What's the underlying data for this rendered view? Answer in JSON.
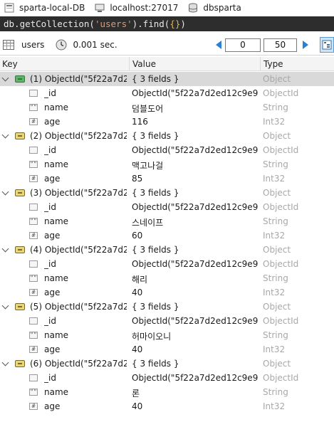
{
  "connection": {
    "db_name": "sparta-local-DB",
    "host": "localhost:27017",
    "database": "dbsparta"
  },
  "query": {
    "prefix": "db.getCollection(",
    "collection_literal": "'users'",
    "middle": ").find(",
    "braces": "{}",
    "suffix": ")"
  },
  "toolbar": {
    "collection": "users",
    "elapsed": "0.001 sec.",
    "skip": "0",
    "limit": "50"
  },
  "columns": {
    "key": "Key",
    "value": "Value",
    "type": "Type"
  },
  "documents": [
    {
      "label": "(1) ObjectId(\"5f22a7d2...",
      "value": "{ 3 fields }",
      "type": "Object",
      "fields": [
        {
          "key": "_id",
          "icon": "objectid-field-icon",
          "glyph": "",
          "value": "ObjectId(\"5f22a7d2ed12c9e9e...",
          "type": "ObjectId"
        },
        {
          "key": "name",
          "icon": "string-field-icon",
          "glyph": "\"\"",
          "value": "덤블도어",
          "type": "String"
        },
        {
          "key": "age",
          "icon": "int-field-icon",
          "glyph": "#",
          "value": "116",
          "type": "Int32"
        }
      ]
    },
    {
      "label": "(2) ObjectId(\"5f22a7d2...",
      "value": "{ 3 fields }",
      "type": "Object",
      "fields": [
        {
          "key": "_id",
          "icon": "objectid-field-icon",
          "glyph": "",
          "value": "ObjectId(\"5f22a7d2ed12c9e9e...",
          "type": "ObjectId"
        },
        {
          "key": "name",
          "icon": "string-field-icon",
          "glyph": "\"\"",
          "value": "맥고나걸",
          "type": "String"
        },
        {
          "key": "age",
          "icon": "int-field-icon",
          "glyph": "#",
          "value": "85",
          "type": "Int32"
        }
      ]
    },
    {
      "label": "(3) ObjectId(\"5f22a7d2...",
      "value": "{ 3 fields }",
      "type": "Object",
      "fields": [
        {
          "key": "_id",
          "icon": "objectid-field-icon",
          "glyph": "",
          "value": "ObjectId(\"5f22a7d2ed12c9e9e...",
          "type": "ObjectId"
        },
        {
          "key": "name",
          "icon": "string-field-icon",
          "glyph": "\"\"",
          "value": "스네이프",
          "type": "String"
        },
        {
          "key": "age",
          "icon": "int-field-icon",
          "glyph": "#",
          "value": "60",
          "type": "Int32"
        }
      ]
    },
    {
      "label": "(4) ObjectId(\"5f22a7d2...",
      "value": "{ 3 fields }",
      "type": "Object",
      "fields": [
        {
          "key": "_id",
          "icon": "objectid-field-icon",
          "glyph": "",
          "value": "ObjectId(\"5f22a7d2ed12c9e9e...",
          "type": "ObjectId"
        },
        {
          "key": "name",
          "icon": "string-field-icon",
          "glyph": "\"\"",
          "value": "해리",
          "type": "String"
        },
        {
          "key": "age",
          "icon": "int-field-icon",
          "glyph": "#",
          "value": "40",
          "type": "Int32"
        }
      ]
    },
    {
      "label": "(5) ObjectId(\"5f22a7d2...",
      "value": "{ 3 fields }",
      "type": "Object",
      "fields": [
        {
          "key": "_id",
          "icon": "objectid-field-icon",
          "glyph": "",
          "value": "ObjectId(\"5f22a7d2ed12c9e9e...",
          "type": "ObjectId"
        },
        {
          "key": "name",
          "icon": "string-field-icon",
          "glyph": "\"\"",
          "value": "허마이오니",
          "type": "String"
        },
        {
          "key": "age",
          "icon": "int-field-icon",
          "glyph": "#",
          "value": "40",
          "type": "Int32"
        }
      ]
    },
    {
      "label": "(6) ObjectId(\"5f22a7d2...",
      "value": "{ 3 fields }",
      "type": "Object",
      "fields": [
        {
          "key": "_id",
          "icon": "objectid-field-icon",
          "glyph": "",
          "value": "ObjectId(\"5f22a7d2ed12c9e9e...",
          "type": "ObjectId"
        },
        {
          "key": "name",
          "icon": "string-field-icon",
          "glyph": "\"\"",
          "value": "론",
          "type": "String"
        },
        {
          "key": "age",
          "icon": "int-field-icon",
          "glyph": "#",
          "value": "40",
          "type": "Int32"
        }
      ]
    }
  ],
  "colors": {
    "query_bg": "#2d2d2d",
    "selected_row": "#d9d9d9",
    "type_text": "#a8a8a8",
    "accent": "#2d7fd3"
  }
}
